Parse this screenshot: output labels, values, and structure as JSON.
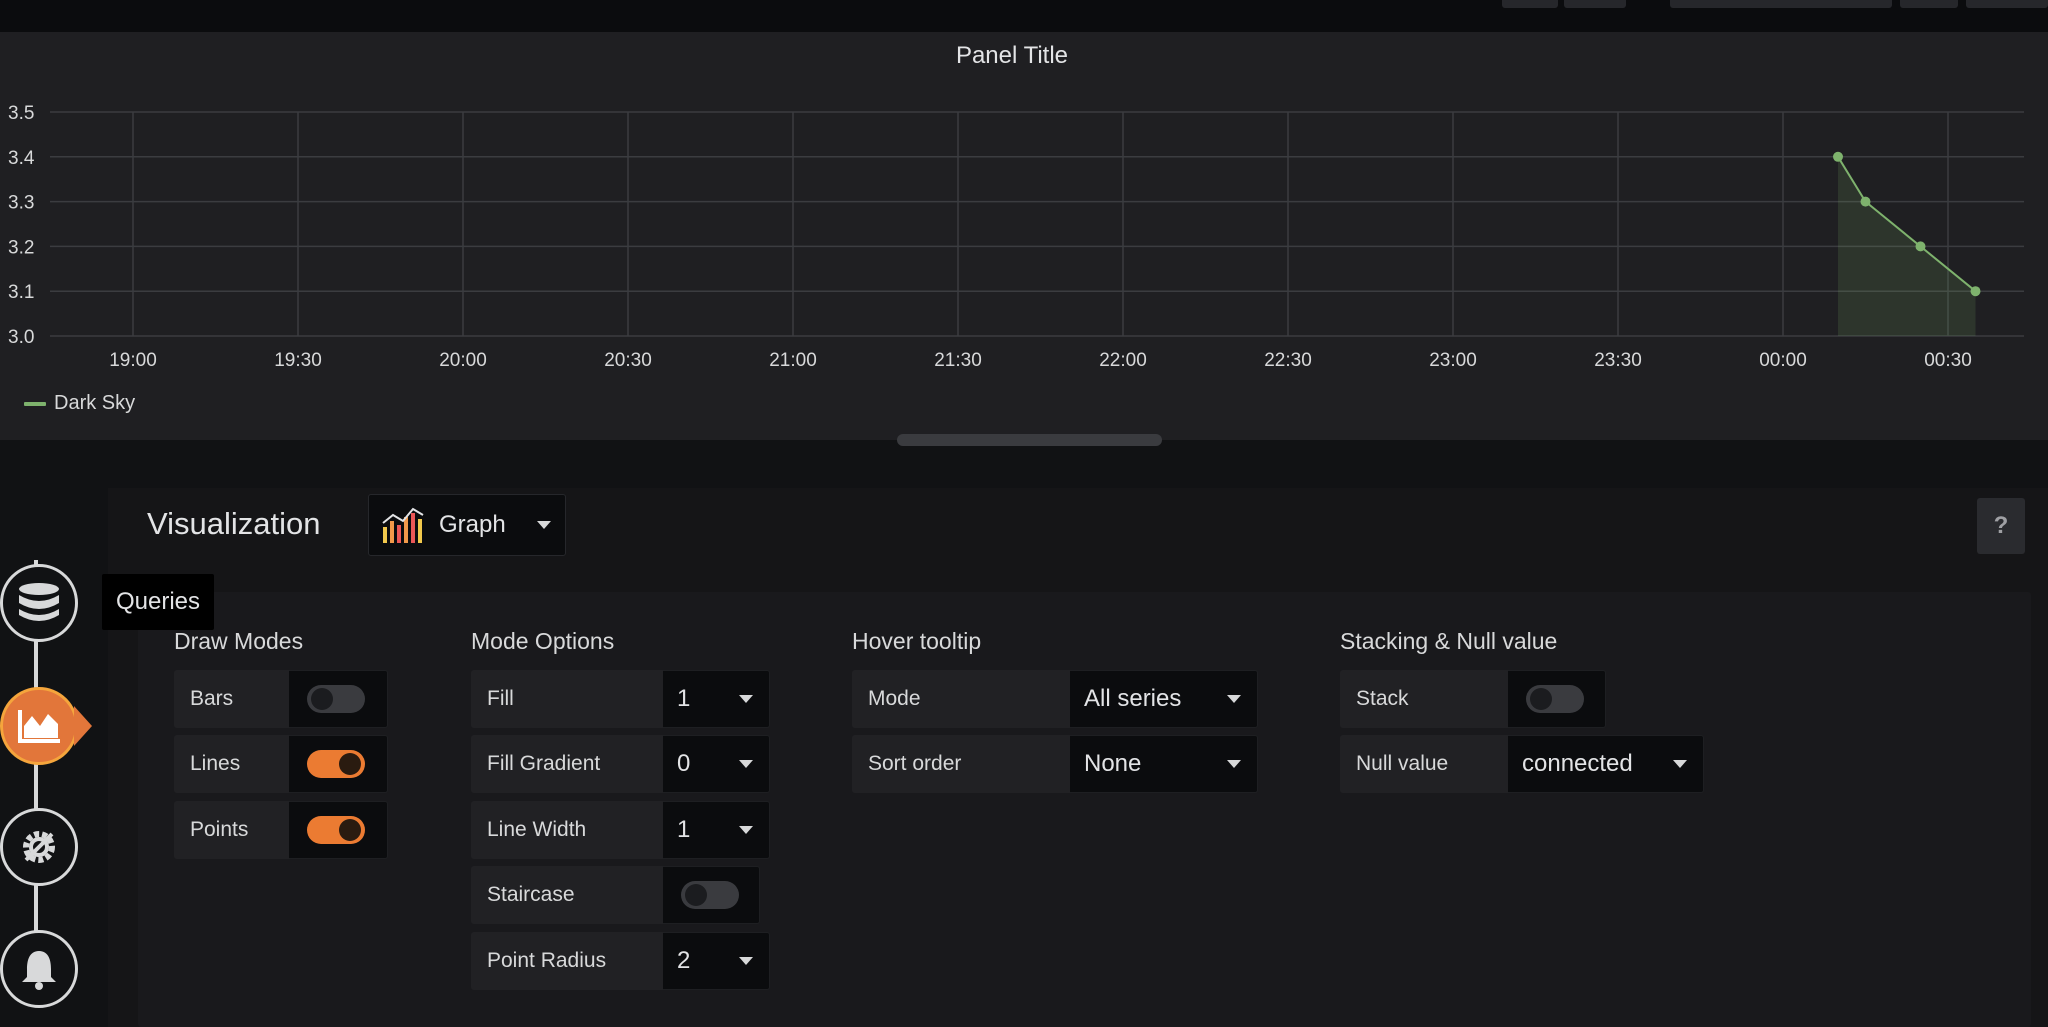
{
  "panel": {
    "title": "Panel Title",
    "legend": [
      {
        "label": "Dark Sky",
        "color": "#7eb26d"
      }
    ]
  },
  "chart_data": {
    "type": "line",
    "title": "Panel Title",
    "x_ticks": [
      "19:00",
      "19:30",
      "20:00",
      "20:30",
      "21:00",
      "21:30",
      "22:00",
      "22:30",
      "23:00",
      "23:30",
      "00:00",
      "00:30"
    ],
    "y_ticks": [
      "3.0",
      "3.1",
      "3.2",
      "3.3",
      "3.4",
      "3.5"
    ],
    "ylim": [
      3.0,
      3.5
    ],
    "series": [
      {
        "name": "Dark Sky",
        "color": "#7eb26d",
        "fill": true,
        "points": true,
        "x": [
          "00:10",
          "00:15",
          "00:25",
          "00:35"
        ],
        "values": [
          3.4,
          3.3,
          3.2,
          3.1
        ]
      }
    ],
    "grid": true,
    "legend_position": "bottom-left"
  },
  "editor": {
    "visualization_label": "Visualization",
    "visualization_value": "Graph",
    "help_label": "?",
    "tooltip": "Queries",
    "nav": [
      {
        "name": "queries",
        "icon": "database-icon"
      },
      {
        "name": "visualization",
        "icon": "chart-icon",
        "active": true
      },
      {
        "name": "general",
        "icon": "gear-icon"
      },
      {
        "name": "alert",
        "icon": "bell-icon"
      }
    ],
    "draw_modes": {
      "title": "Draw Modes",
      "bars": {
        "label": "Bars",
        "on": false
      },
      "lines": {
        "label": "Lines",
        "on": true
      },
      "points": {
        "label": "Points",
        "on": true
      }
    },
    "mode_options": {
      "title": "Mode Options",
      "fill": {
        "label": "Fill",
        "value": "1"
      },
      "fill_gradient": {
        "label": "Fill Gradient",
        "value": "0"
      },
      "line_width": {
        "label": "Line Width",
        "value": "1"
      },
      "staircase": {
        "label": "Staircase",
        "on": false
      },
      "point_radius": {
        "label": "Point Radius",
        "value": "2"
      }
    },
    "hover_tooltip": {
      "title": "Hover tooltip",
      "mode": {
        "label": "Mode",
        "value": "All series"
      },
      "sort_order": {
        "label": "Sort order",
        "value": "None"
      }
    },
    "stacking": {
      "title": "Stacking & Null value",
      "stack": {
        "label": "Stack",
        "on": false
      },
      "null_value": {
        "label": "Null value",
        "value": "connected"
      }
    }
  }
}
